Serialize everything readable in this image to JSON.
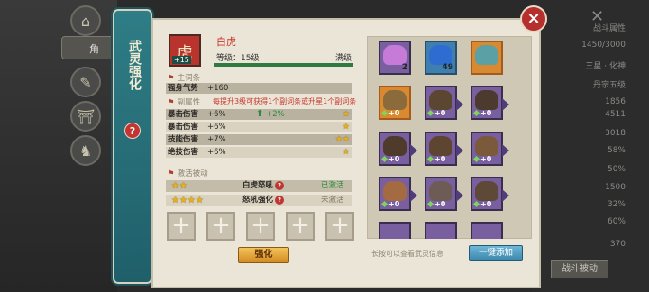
{
  "background": {
    "tab_label": "角",
    "right_rows": [
      "战斗属性",
      "1450/3000",
      "三星 · 化神",
      "丹宗五级",
      "1856",
      "4511",
      "3018",
      "58%",
      "50%",
      "1500",
      "32%",
      "60%",
      "370"
    ],
    "right_button": "战斗被动"
  },
  "side_title": {
    "text": "武灵强化",
    "help": "?"
  },
  "hero": {
    "name": "白虎",
    "level_label": "等级：15级",
    "level_max": "满级",
    "level_fraction": 1.0,
    "portrait_badge": "+15"
  },
  "main_affix": {
    "header": "主词条",
    "name": "强身气势",
    "value": "+160"
  },
  "sub_affix": {
    "header": "副属性",
    "tip": "每提升3级可获得1个副词条或升星1个副词条",
    "rows": [
      {
        "name": "暴击伤害",
        "value": "+6%",
        "stars": "★",
        "up": "+2%"
      },
      {
        "name": "暴击伤害",
        "value": "+6%",
        "stars": "★"
      },
      {
        "name": "技能伤害",
        "value": "+7%",
        "stars": "★★"
      },
      {
        "name": "绝技伤害",
        "value": "+6%",
        "stars": "★"
      }
    ]
  },
  "activation": {
    "header": "激活被动",
    "rows": [
      {
        "stars": "★★",
        "combo": "白虎怒吼",
        "state": "已激活",
        "state_color": "#2e8a3f"
      },
      {
        "stars": "★★★★",
        "combo": "怒吼强化",
        "state": "未激活",
        "state_color": "#7d7366"
      }
    ]
  },
  "slots": [
    "+",
    "+",
    "+",
    "+",
    "+"
  ],
  "strengthen_button": "强化",
  "grid": {
    "cards": [
      {
        "style": "purple",
        "count": "2",
        "art": "#c67bd9"
      },
      {
        "style": "blue",
        "count": "49",
        "art": "#2f6cd1"
      },
      {
        "style": "gold",
        "count": "",
        "art": "#5aa0a4"
      },
      {
        "style": "gold",
        "lv": "+0",
        "art": "#8b6b3b"
      },
      {
        "style": "purple",
        "lv": "+0",
        "art": "#5b4632"
      },
      {
        "style": "purple",
        "lv": "+0",
        "art": "#4b3a2d"
      },
      {
        "style": "purple",
        "lv": "+0",
        "art": "#4e3b2c"
      },
      {
        "style": "purple",
        "lv": "+0",
        "art": "#5e4532"
      },
      {
        "style": "purple",
        "lv": "+0",
        "art": "#7a5a3a"
      },
      {
        "style": "purple",
        "lv": "+0",
        "art": "#a46b43"
      },
      {
        "style": "purple",
        "lv": "+0",
        "art": "#6d5b55"
      },
      {
        "style": "purple",
        "lv": "+0",
        "art": "#5e4838"
      }
    ],
    "hint": "长按可以查看武灵信息",
    "auto_button": "一键添加"
  },
  "close_icon": "×"
}
